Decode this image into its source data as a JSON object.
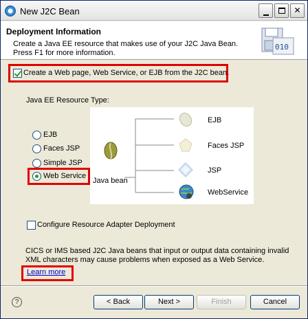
{
  "window": {
    "title": "New J2C Bean"
  },
  "header": {
    "title": "Deployment Information",
    "description": "Create a Java EE resource that makes use of your J2C Java Bean. Press F1 for more information."
  },
  "create_option": {
    "label": "Create a Web page, Web Service, or EJB from the J2C bean.",
    "checked": true
  },
  "resource_type": {
    "label": "Java EE Resource Type:",
    "options": [
      {
        "label": "EJB",
        "selected": false
      },
      {
        "label": "Faces JSP",
        "selected": false
      },
      {
        "label": "Simple JSP",
        "selected": false
      },
      {
        "label": "Web Service",
        "selected": true
      }
    ]
  },
  "diagram": {
    "source": "Java bean",
    "targets": [
      "EJB",
      "Faces JSP",
      "JSP",
      "WebService"
    ]
  },
  "configure_option": {
    "label": "Configure Resource Adapter Deployment",
    "checked": false
  },
  "warning": {
    "text": "CICS or IMS based J2C Java beans that input or output data containing invalid XML characters may cause problems when exposed as a Web Service.",
    "link": "Learn more"
  },
  "buttons": {
    "help": "?",
    "back": "< Back",
    "next": "Next >",
    "finish": "Finish",
    "cancel": "Cancel"
  },
  "colors": {
    "highlight": "#e00000",
    "link": "#0000cc"
  }
}
